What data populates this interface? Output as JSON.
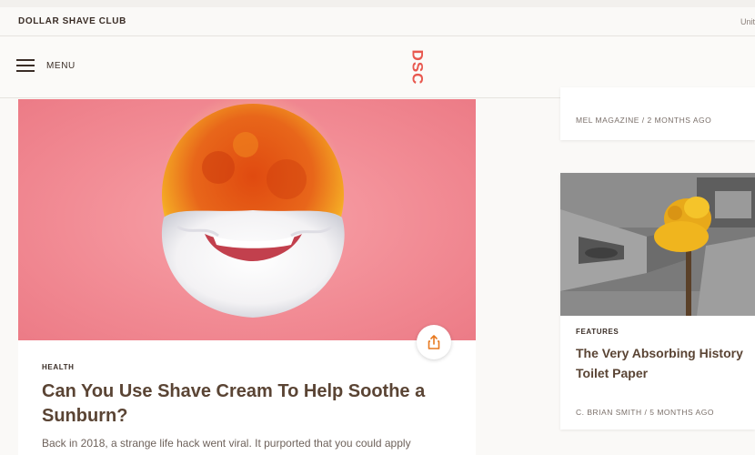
{
  "header": {
    "brand": "DOLLAR SHAVE CLUB",
    "region": "Unit",
    "menu_label": "MENU",
    "logo_text": "DSC"
  },
  "colors": {
    "accent": "#e8584f",
    "hero_bg": "#f28c95",
    "share_icon": "#e8791f",
    "title": "#5a4434"
  },
  "main_article": {
    "category": "HEALTH",
    "title_line1": "Can You Use Shave Cream To Help Soothe a",
    "title_line2": "Sunburn?",
    "excerpt": "Back in 2018, a strange life hack went viral. It purported that you could apply",
    "share_icon": "share-icon"
  },
  "side_articles": [
    {
      "meta": "MEL MAGAZINE / 2 MONTHS AGO"
    },
    {
      "category": "FEATURES",
      "title_line1": "The Very Absorbing History",
      "title_line2": "Toilet Paper",
      "meta": "C. BRIAN SMITH / 5 MONTHS AGO"
    }
  ]
}
